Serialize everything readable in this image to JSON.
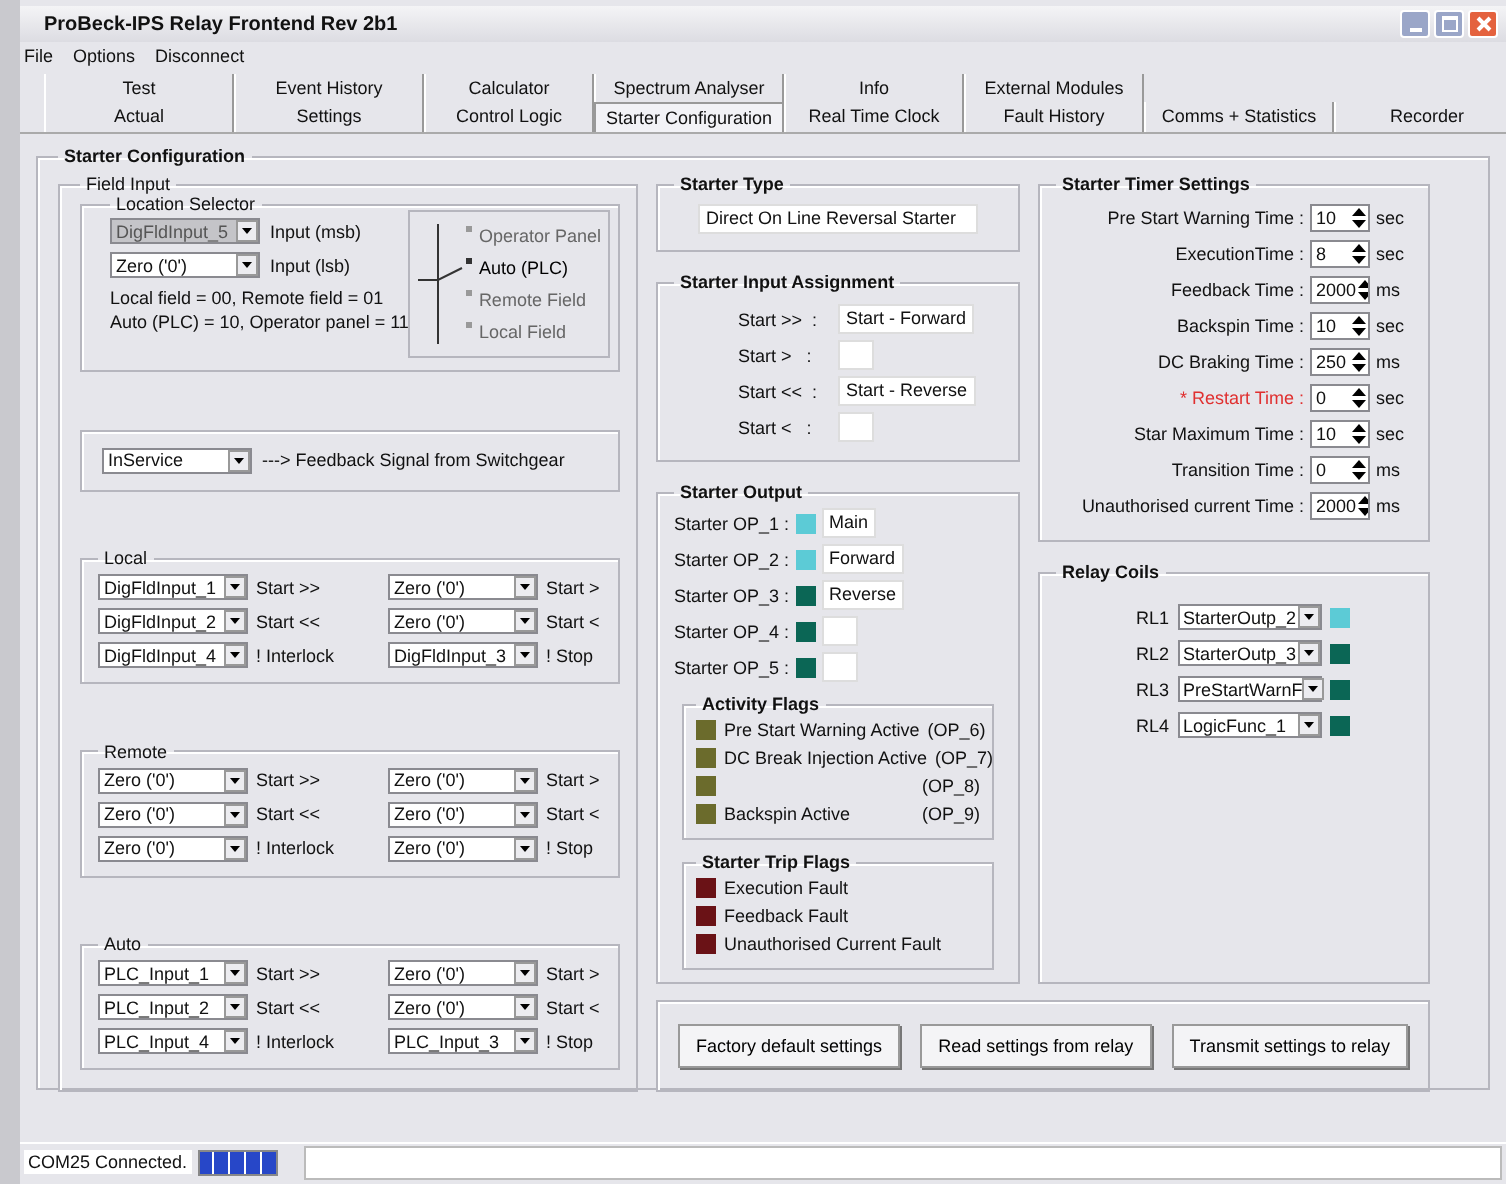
{
  "window": {
    "title": "ProBeck-IPS Relay Frontend Rev 2b1"
  },
  "menu": [
    "File",
    "Options",
    "Disconnect"
  ],
  "tab_rows": [
    [
      {
        "label": "Test",
        "selected": false
      },
      {
        "label": "Event History",
        "selected": false
      },
      {
        "label": "Calculator",
        "selected": false
      },
      {
        "label": "Spectrum Analyser",
        "selected": false
      },
      {
        "label": "Info",
        "selected": false
      },
      {
        "label": "External Modules",
        "selected": false
      }
    ],
    [
      {
        "label": "Actual",
        "selected": false
      },
      {
        "label": "Settings",
        "selected": false
      },
      {
        "label": "Control Logic",
        "selected": false
      },
      {
        "label": "Starter Configuration",
        "selected": true
      },
      {
        "label": "Real Time Clock",
        "selected": false
      },
      {
        "label": "Fault History",
        "selected": false
      },
      {
        "label": "Comms + Statistics",
        "selected": false
      },
      {
        "label": "Recorder",
        "selected": false
      }
    ]
  ],
  "panel": {
    "title": "Starter Configuration"
  },
  "field_input": {
    "title": "Field Input",
    "location_selector": {
      "title": "Location Selector",
      "inputs": [
        {
          "value": "DigFldInput_5",
          "label": "Input (msb)",
          "disabled": true
        },
        {
          "value": "Zero ('0')",
          "label": "Input (lsb)",
          "disabled": false
        }
      ],
      "notes": [
        "Local field =  00,   Remote field =  01",
        "Auto (PLC) = 10,  Operator panel = 11"
      ],
      "positions": [
        {
          "label": "Operator Panel",
          "selected": false
        },
        {
          "label": "Auto (PLC)",
          "selected": true
        },
        {
          "label": "Remote Field",
          "selected": false
        },
        {
          "label": "Local Field",
          "selected": false
        }
      ]
    },
    "feedback": {
      "value": "InService",
      "label": "---> Feedback Signal from Switchgear"
    },
    "groups": [
      {
        "title": "Local",
        "rows": [
          {
            "left": {
              "value": "DigFldInput_1",
              "label": "Start >>"
            },
            "right": {
              "value": "Zero ('0')",
              "label": "Start >"
            }
          },
          {
            "left": {
              "value": "DigFldInput_2",
              "label": "Start <<"
            },
            "right": {
              "value": "Zero ('0')",
              "label": "Start <"
            }
          },
          {
            "left": {
              "value": "DigFldInput_4",
              "label": "! Interlock"
            },
            "right": {
              "value": "DigFldInput_3",
              "label": "! Stop"
            }
          }
        ]
      },
      {
        "title": "Remote",
        "rows": [
          {
            "left": {
              "value": "Zero ('0')",
              "label": "Start >>"
            },
            "right": {
              "value": "Zero ('0')",
              "label": "Start >"
            }
          },
          {
            "left": {
              "value": "Zero ('0')",
              "label": "Start <<"
            },
            "right": {
              "value": "Zero ('0')",
              "label": "Start <"
            }
          },
          {
            "left": {
              "value": "Zero ('0')",
              "label": "! Interlock"
            },
            "right": {
              "value": "Zero ('0')",
              "label": "! Stop"
            }
          }
        ]
      },
      {
        "title": "Auto",
        "rows": [
          {
            "left": {
              "value": "PLC_Input_1",
              "label": "Start >>"
            },
            "right": {
              "value": "Zero ('0')",
              "label": "Start >"
            }
          },
          {
            "left": {
              "value": "PLC_Input_2",
              "label": "Start <<"
            },
            "right": {
              "value": "Zero ('0')",
              "label": "Start <"
            }
          },
          {
            "left": {
              "value": "PLC_Input_4",
              "label": "! Interlock"
            },
            "right": {
              "value": "PLC_Input_3",
              "label": "! Stop"
            }
          }
        ]
      }
    ]
  },
  "starter_type": {
    "title": "Starter Type",
    "value": "Direct On Line Reversal Starter"
  },
  "input_assignment": {
    "title": "Starter Input Assignment",
    "rows": [
      {
        "label": "Start >>  :",
        "value": "Start - Forward"
      },
      {
        "label": "Start >   :"
      },
      {
        "label": "Start <<  :",
        "value": "Start - Reverse"
      },
      {
        "label": "Start <   :"
      }
    ]
  },
  "starter_output": {
    "title": "Starter Output",
    "rows": [
      {
        "label": "Starter OP_1 :",
        "color": "#5ccbd6",
        "value": "Main"
      },
      {
        "label": "Starter OP_2 :",
        "color": "#5ccbd6",
        "value": "Forward"
      },
      {
        "label": "Starter OP_3 :",
        "color": "#0b6655",
        "value": "Reverse"
      },
      {
        "label": "Starter OP_4 :",
        "color": "#0b6655"
      },
      {
        "label": "Starter OP_5 :",
        "color": "#0b6655"
      }
    ],
    "activity_flags": {
      "title": "Activity Flags",
      "items": [
        {
          "label": "Pre Start Warning Active",
          "op": "(OP_6)",
          "color": "#6b6b2c"
        },
        {
          "label": "DC Break Injection Active",
          "op": "(OP_7)",
          "color": "#6b6b2c"
        },
        {
          "op": "(OP_8)",
          "color": "#6b6b2c"
        },
        {
          "label": "Backspin Active",
          "op": "(OP_9)",
          "color": "#6b6b2c"
        }
      ]
    },
    "trip_flags": {
      "title": "Starter Trip Flags",
      "items": [
        {
          "label": "Execution Fault",
          "color": "#6a1216"
        },
        {
          "label": "Feedback Fault",
          "color": "#6a1216"
        },
        {
          "label": "Unauthorised Current Fault",
          "color": "#6a1216"
        }
      ]
    }
  },
  "timer_settings": {
    "title": "Starter Timer Settings",
    "rows": [
      {
        "label": "Pre Start Warning Time :",
        "value": "10",
        "unit": "sec",
        "required": false
      },
      {
        "label": "ExecutionTime :",
        "value": "8",
        "unit": "sec",
        "required": false
      },
      {
        "label": "Feedback Time :",
        "value": "2000",
        "unit": "ms",
        "required": false
      },
      {
        "label": "Backspin Time :",
        "value": "10",
        "unit": "sec",
        "required": false
      },
      {
        "label": "DC Braking Time :",
        "value": "250",
        "unit": "ms",
        "required": false
      },
      {
        "label": "* Restart Time :",
        "value": "0",
        "unit": "sec",
        "required": true
      },
      {
        "label": "Star Maximum Time :",
        "value": "10",
        "unit": "sec",
        "required": false
      },
      {
        "label": "Transition Time :",
        "value": "0",
        "unit": "ms",
        "required": false
      },
      {
        "label": "Unauthorised current Time :",
        "value": "2000",
        "unit": "ms",
        "required": false
      }
    ]
  },
  "relay_coils": {
    "title": "Relay Coils",
    "rows": [
      {
        "label": "RL1",
        "value": "StarterOutp_2",
        "color": "#5ccbd6"
      },
      {
        "label": "RL2",
        "value": "StarterOutp_3",
        "color": "#0b6655"
      },
      {
        "label": "RL3",
        "value": "PreStartWarnF",
        "color": "#0b6655"
      },
      {
        "label": "RL4",
        "value": "LogicFunc_1",
        "color": "#0b6655"
      }
    ]
  },
  "buttons": [
    "Factory default settings",
    "Read settings from relay",
    "Transmit settings to relay"
  ],
  "status_bar": {
    "text": "COM25 Connected.",
    "level": 1
  }
}
